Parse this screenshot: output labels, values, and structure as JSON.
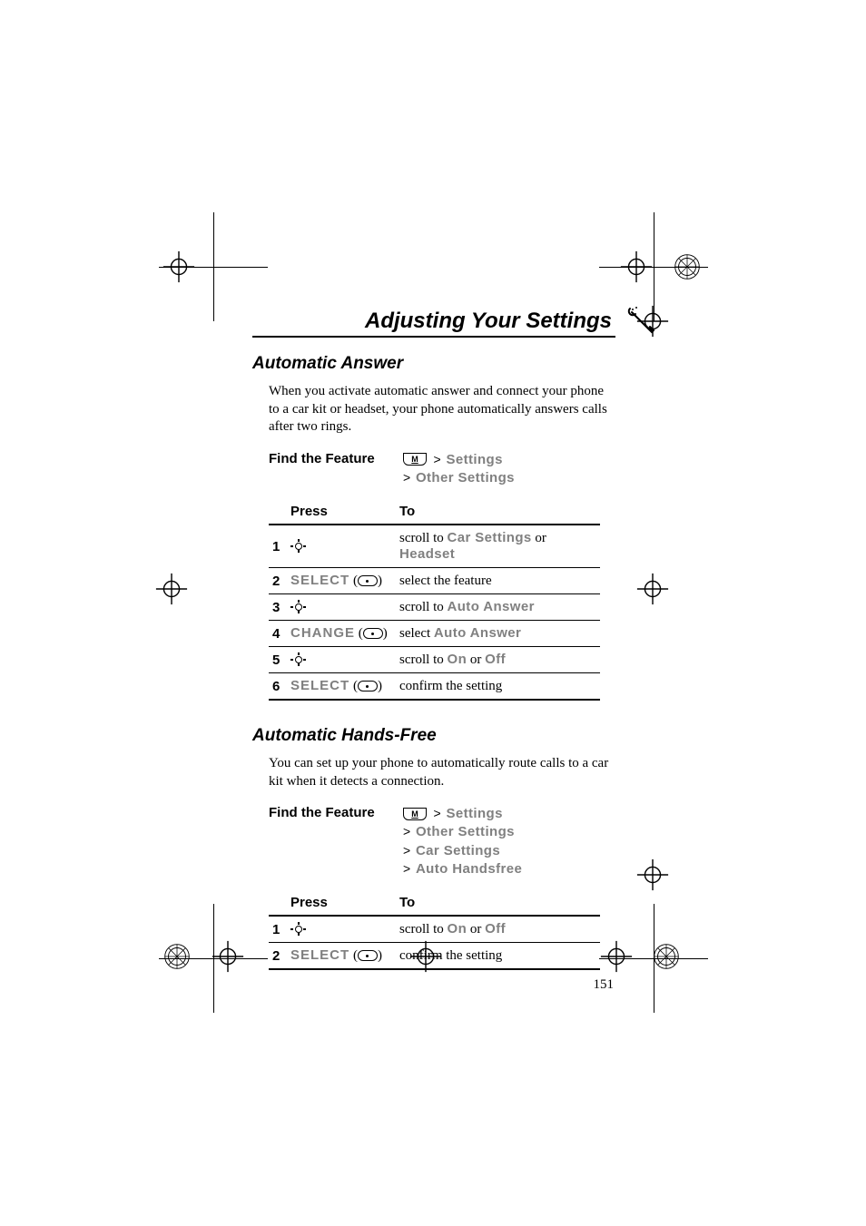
{
  "chapter_title": "Adjusting Your Settings",
  "page_number": "151",
  "menu_key_label": "M",
  "section1": {
    "title": "Automatic Answer",
    "body": "When you activate automatic answer and connect your phone to a car kit or headset, your phone automatically answers calls after two rings.",
    "find_label": "Find the Feature",
    "path": [
      "Settings",
      "Other Settings"
    ],
    "table": {
      "headers": {
        "press": "Press",
        "to": "To"
      },
      "rows": [
        {
          "num": "1",
          "press_type": "nav",
          "to_prefix": "scroll to ",
          "to_tt1": "Car Settings",
          "to_mid": " or ",
          "to_tt2": "Headset"
        },
        {
          "num": "2",
          "press_type": "soft",
          "soft_label": "SELECT",
          "to_prefix": "select the feature"
        },
        {
          "num": "3",
          "press_type": "nav",
          "to_prefix": "scroll to ",
          "to_tt1": "Auto Answer"
        },
        {
          "num": "4",
          "press_type": "soft",
          "soft_label": "CHANGE",
          "to_prefix": "select ",
          "to_tt1": "Auto Answer"
        },
        {
          "num": "5",
          "press_type": "nav",
          "to_prefix": "scroll to ",
          "to_tt1": "On",
          "to_mid": " or ",
          "to_tt2": "Off"
        },
        {
          "num": "6",
          "press_type": "soft",
          "soft_label": "SELECT",
          "to_prefix": "confirm the setting"
        }
      ]
    }
  },
  "section2": {
    "title": "Automatic Hands-Free",
    "body": "You can set up your phone to automatically route calls to a car kit when it detects a connection.",
    "find_label": "Find the Feature",
    "path": [
      "Settings",
      "Other Settings",
      "Car Settings",
      "Auto Handsfree"
    ],
    "table": {
      "headers": {
        "press": "Press",
        "to": "To"
      },
      "rows": [
        {
          "num": "1",
          "press_type": "nav",
          "to_prefix": "scroll to ",
          "to_tt1": "On",
          "to_mid": " or ",
          "to_tt2": "Off"
        },
        {
          "num": "2",
          "press_type": "soft",
          "soft_label": "SELECT",
          "to_prefix": "confirm the setting"
        }
      ]
    }
  }
}
